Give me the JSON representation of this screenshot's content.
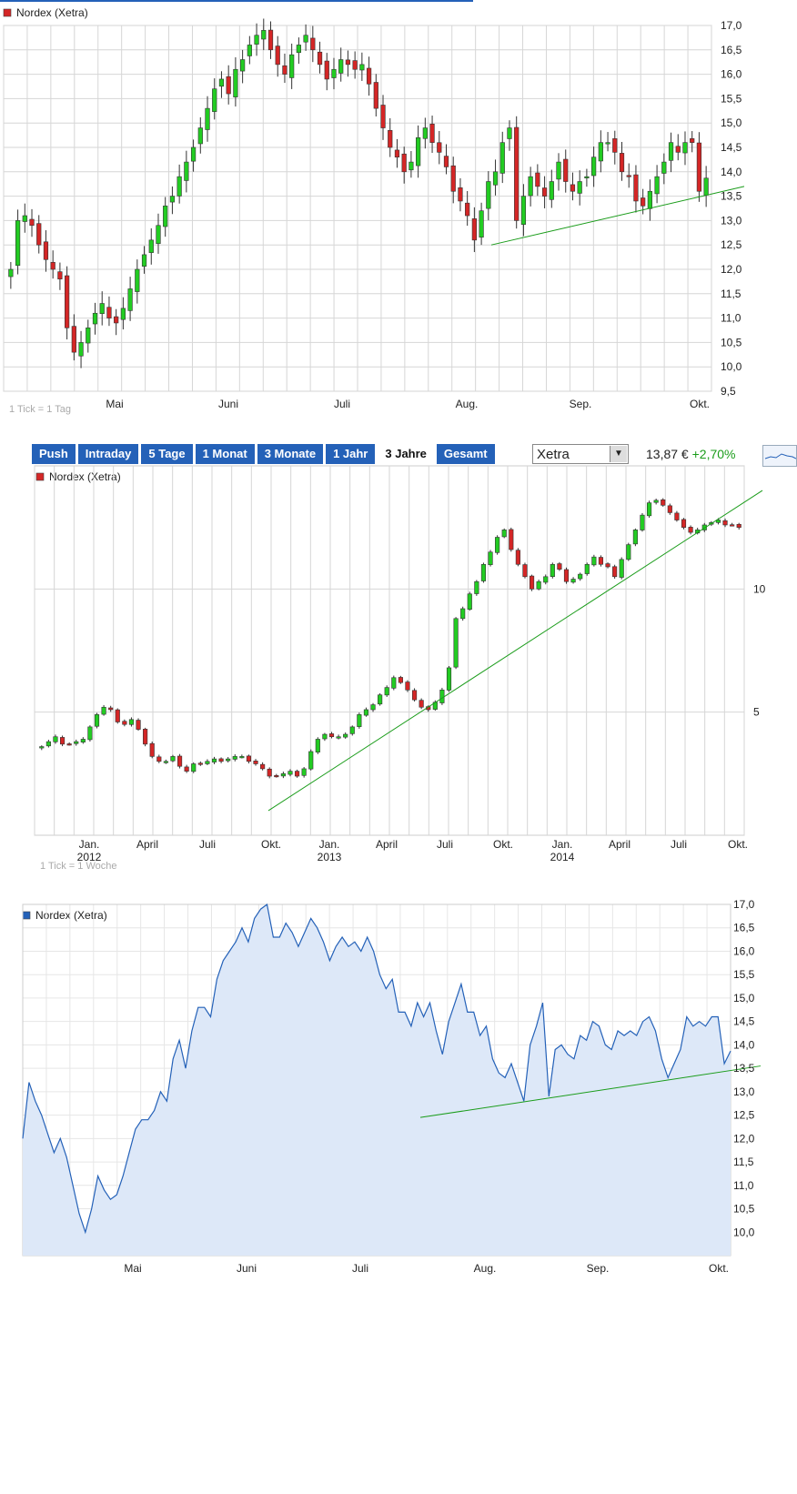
{
  "colors": {
    "up": "#22cc22",
    "down": "#d42626",
    "trend": "#1a9c1a",
    "area_line": "#2461b8",
    "area_fill": "#dde8f8",
    "grid": "#d6d6d6",
    "button": "#2461b8"
  },
  "toolbar": {
    "buttons": [
      "Push",
      "Intraday",
      "5 Tage",
      "1 Monat",
      "3 Monate",
      "1 Jahr",
      "3 Jahre",
      "Gesamt"
    ],
    "active": "3 Jahre",
    "exchange": "Xetra",
    "price": "13,87 €",
    "change": "+2,70%"
  },
  "chart_data": [
    {
      "type": "candlestick",
      "legend": "Nordex (Xetra)",
      "note": "1 Tick = 1 Tag",
      "ylim": [
        9.5,
        17.0
      ],
      "yticks": [
        "17,0",
        "16,5",
        "16,0",
        "15,5",
        "15,0",
        "14,5",
        "14,0",
        "13,5",
        "13,0",
        "12,5",
        "12,0",
        "11,5",
        "11,0",
        "10,5",
        "10,0",
        "9,5"
      ],
      "xticks": [
        "Mai",
        "Juni",
        "Juli",
        "Aug.",
        "Sep.",
        "Okt."
      ],
      "close": [
        12.0,
        13.0,
        13.1,
        12.9,
        12.5,
        12.2,
        12.0,
        11.8,
        10.8,
        10.3,
        10.5,
        10.8,
        11.1,
        11.3,
        11.0,
        10.9,
        11.2,
        11.6,
        12.0,
        12.3,
        12.6,
        12.9,
        13.3,
        13.5,
        13.9,
        14.2,
        14.5,
        14.9,
        15.3,
        15.7,
        15.9,
        15.6,
        16.1,
        16.3,
        16.6,
        16.8,
        16.9,
        16.5,
        16.2,
        16.0,
        16.4,
        16.6,
        16.8,
        16.5,
        16.2,
        15.9,
        16.1,
        16.3,
        16.2,
        16.1,
        16.2,
        15.8,
        15.3,
        14.9,
        14.5,
        14.3,
        14.0,
        14.2,
        14.7,
        14.9,
        14.6,
        14.4,
        14.1,
        13.6,
        13.4,
        13.1,
        12.6,
        13.2,
        13.8,
        14.0,
        14.6,
        14.9,
        13.0,
        13.5,
        13.9,
        13.7,
        13.5,
        13.8,
        14.2,
        13.8,
        13.6,
        13.8,
        13.9,
        14.3,
        14.6,
        14.6,
        14.4,
        14.0,
        13.9,
        13.4,
        13.3,
        13.6,
        13.9,
        14.2,
        14.6,
        14.4,
        14.6,
        14.6,
        13.6,
        13.87
      ],
      "trendline": {
        "from": [
          "Aug.",
          12.5
        ],
        "to": [
          "Okt.+",
          13.7
        ]
      }
    },
    {
      "type": "candlestick",
      "legend": "Nordex (Xetra)",
      "note": "1 Tick = 1 Woche",
      "ylim": [
        0,
        15
      ],
      "yticks": [
        "10",
        "5"
      ],
      "xticks": [
        "Jan.",
        "April",
        "Juli",
        "Okt.",
        "Jan.",
        "April",
        "Juli",
        "Okt.",
        "Jan.",
        "April",
        "Juli",
        "Okt."
      ],
      "xyears": [
        "2012",
        "2013",
        "2014"
      ],
      "close": [
        3.6,
        3.8,
        4.0,
        3.7,
        3.7,
        3.8,
        3.9,
        4.4,
        4.9,
        5.2,
        5.1,
        4.6,
        4.5,
        4.7,
        4.3,
        3.7,
        3.2,
        3.0,
        3.0,
        3.2,
        2.8,
        2.6,
        2.9,
        2.9,
        3.0,
        3.1,
        3.0,
        3.1,
        3.2,
        3.2,
        3.0,
        2.9,
        2.7,
        2.4,
        2.4,
        2.5,
        2.6,
        2.4,
        2.7,
        3.4,
        3.9,
        4.1,
        4.0,
        4.0,
        4.1,
        4.4,
        4.9,
        5.1,
        5.3,
        5.7,
        6.0,
        6.4,
        6.2,
        5.9,
        5.5,
        5.2,
        5.1,
        5.4,
        5.9,
        6.8,
        8.8,
        9.2,
        9.8,
        10.3,
        11.0,
        11.5,
        12.1,
        12.4,
        11.6,
        11.0,
        10.5,
        10.0,
        10.3,
        10.5,
        11.0,
        10.8,
        10.3,
        10.4,
        10.6,
        11.0,
        11.3,
        11.0,
        10.9,
        10.5,
        11.2,
        11.8,
        12.4,
        13.0,
        13.5,
        13.6,
        13.4,
        13.1,
        12.8,
        12.5,
        12.3,
        12.4,
        12.6,
        12.7,
        12.8,
        12.6,
        12.6,
        12.5
      ],
      "trendline": {
        "from": [
          "Okt. 2012",
          1.0
        ],
        "to": [
          "Okt. 2014+",
          14.0
        ]
      }
    },
    {
      "type": "area",
      "legend": "Nordex (Xetra)",
      "ylim": [
        9.5,
        17.0
      ],
      "yticks": [
        "17,0",
        "16,5",
        "16,0",
        "15,5",
        "15,0",
        "14,5",
        "14,0",
        "13,5",
        "13,0",
        "12,5",
        "12,0",
        "11,5",
        "11,0",
        "10,5",
        "10,0"
      ],
      "xticks": [
        "Mai",
        "Juni",
        "Juli",
        "Aug.",
        "Sep.",
        "Okt."
      ],
      "values": [
        12.0,
        13.2,
        12.8,
        12.5,
        12.1,
        11.7,
        12.0,
        11.6,
        11.0,
        10.4,
        10.0,
        10.5,
        11.2,
        10.9,
        10.7,
        10.8,
        11.2,
        11.7,
        12.2,
        12.4,
        12.4,
        12.6,
        13.0,
        12.8,
        13.7,
        14.1,
        13.5,
        14.3,
        14.8,
        14.8,
        14.6,
        15.4,
        15.8,
        16.0,
        16.2,
        16.5,
        16.2,
        16.7,
        16.9,
        17.0,
        16.3,
        16.3,
        16.6,
        16.4,
        16.1,
        16.4,
        16.7,
        16.5,
        16.2,
        15.8,
        16.1,
        16.3,
        16.1,
        16.2,
        16.0,
        16.3,
        16.0,
        15.5,
        15.2,
        15.4,
        14.7,
        14.7,
        14.4,
        14.9,
        14.6,
        14.9,
        14.3,
        13.8,
        14.5,
        14.9,
        15.3,
        14.7,
        14.7,
        14.2,
        14.4,
        13.7,
        13.4,
        13.3,
        13.6,
        13.2,
        12.8,
        14.0,
        14.4,
        14.9,
        12.9,
        13.9,
        14.0,
        13.8,
        13.7,
        14.2,
        14.1,
        14.5,
        14.4,
        14.0,
        13.9,
        14.3,
        14.2,
        14.3,
        14.2,
        14.5,
        14.6,
        14.3,
        13.7,
        13.3,
        13.6,
        13.9,
        14.6,
        14.4,
        14.5,
        14.4,
        14.6,
        14.6,
        13.6,
        13.87
      ],
      "trendline": {
        "from": [
          "Juli+",
          12.45
        ],
        "to": [
          "Okt.+",
          13.55
        ]
      }
    }
  ]
}
